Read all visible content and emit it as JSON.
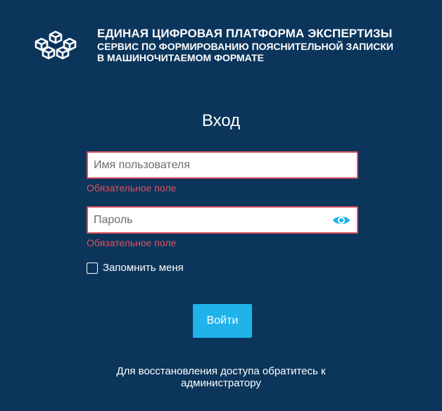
{
  "header": {
    "logo_icon": "cubes-network-icon",
    "title": "ЕДИНАЯ ЦИФРОВАЯ ПЛАТФОРМА ЭКСПЕРТИЗЫ",
    "subtitle_line1": "СЕРВИС ПО ФОРМИРОВАНИЮ ПОЯСНИТЕЛЬНОЙ ЗАПИСКИ",
    "subtitle_line2": "В МАШИНОЧИТАЕМОМ ФОРМАТЕ"
  },
  "login": {
    "title": "Вход",
    "username": {
      "value": "",
      "placeholder": "Имя пользователя",
      "error": "Обязательное поле"
    },
    "password": {
      "value": "",
      "placeholder": "Пароль",
      "error": "Обязательное поле",
      "toggle_icon": "eye-icon"
    },
    "remember": {
      "label": "Запомнить меня",
      "checked": false
    },
    "submit_label": "Войти",
    "recover_line1": "Для восстановления доступа обратитесь к",
    "recover_line2": "администратору"
  },
  "colors": {
    "background": "#0b355b",
    "error": "#e0505e",
    "accent": "#1fb3ea",
    "text": "#ffffff"
  }
}
